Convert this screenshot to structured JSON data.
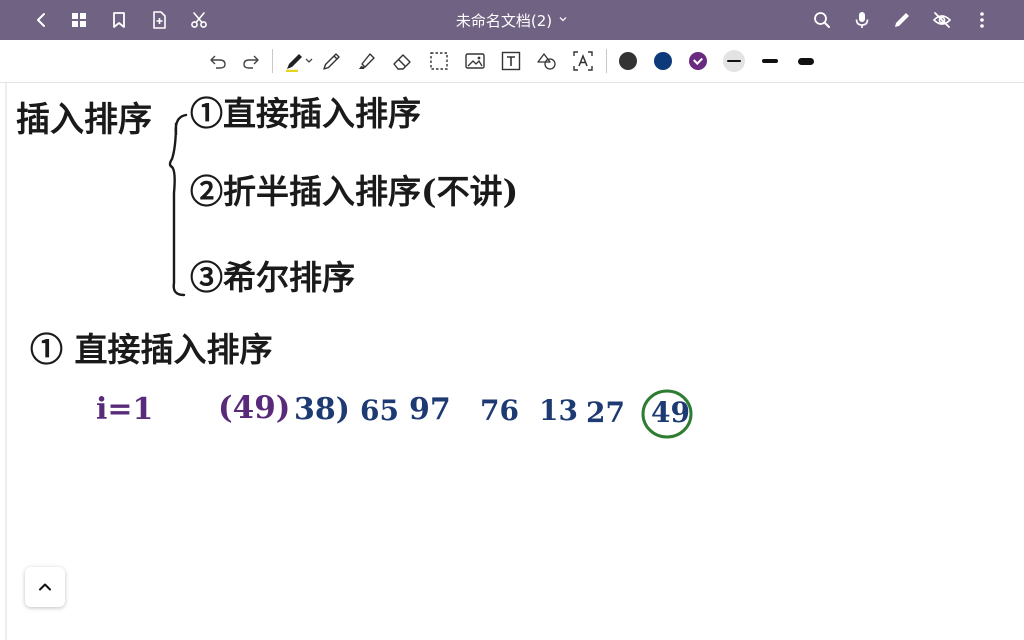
{
  "header": {
    "title": "未命名文档(2)",
    "left_icons": [
      "back-icon",
      "grid-icon",
      "bookmark-icon",
      "add-page-icon",
      "scissors-icon"
    ],
    "right_icons": [
      "search-icon",
      "microphone-icon",
      "pen-icon",
      "eye-off-icon",
      "more-vertical-icon"
    ]
  },
  "toolbar": {
    "tools": [
      "undo-icon",
      "redo-icon",
      "pen-tool-icon",
      "pencil-icon",
      "highlighter-icon",
      "eraser-icon",
      "lasso-select-icon",
      "image-icon",
      "text-icon",
      "shapes-icon",
      "ocr-text-icon"
    ],
    "colors": [
      "#333333",
      "#0c3a7a",
      "#6a2a80"
    ],
    "selected_color": "#6a2a80",
    "pen_accent": "#e8d420",
    "sizes": [
      "thin",
      "medium",
      "thick"
    ],
    "selected_size": "thin"
  },
  "notes": {
    "heading": "插入排序",
    "items": [
      "①直接插入排序",
      "②折半插入排序(不讲)",
      "③希尔排序"
    ],
    "section_title": "① 直接插入排序",
    "index_label": "i=1",
    "sequence": [
      "(49)",
      "38)",
      "65",
      "97",
      "76",
      "13",
      "27",
      "49"
    ],
    "ink_colors": {
      "black": "#1a1a1a",
      "purple": "#5a2a7a",
      "blue": "#1e3a72",
      "green": "#2e7d32"
    }
  }
}
